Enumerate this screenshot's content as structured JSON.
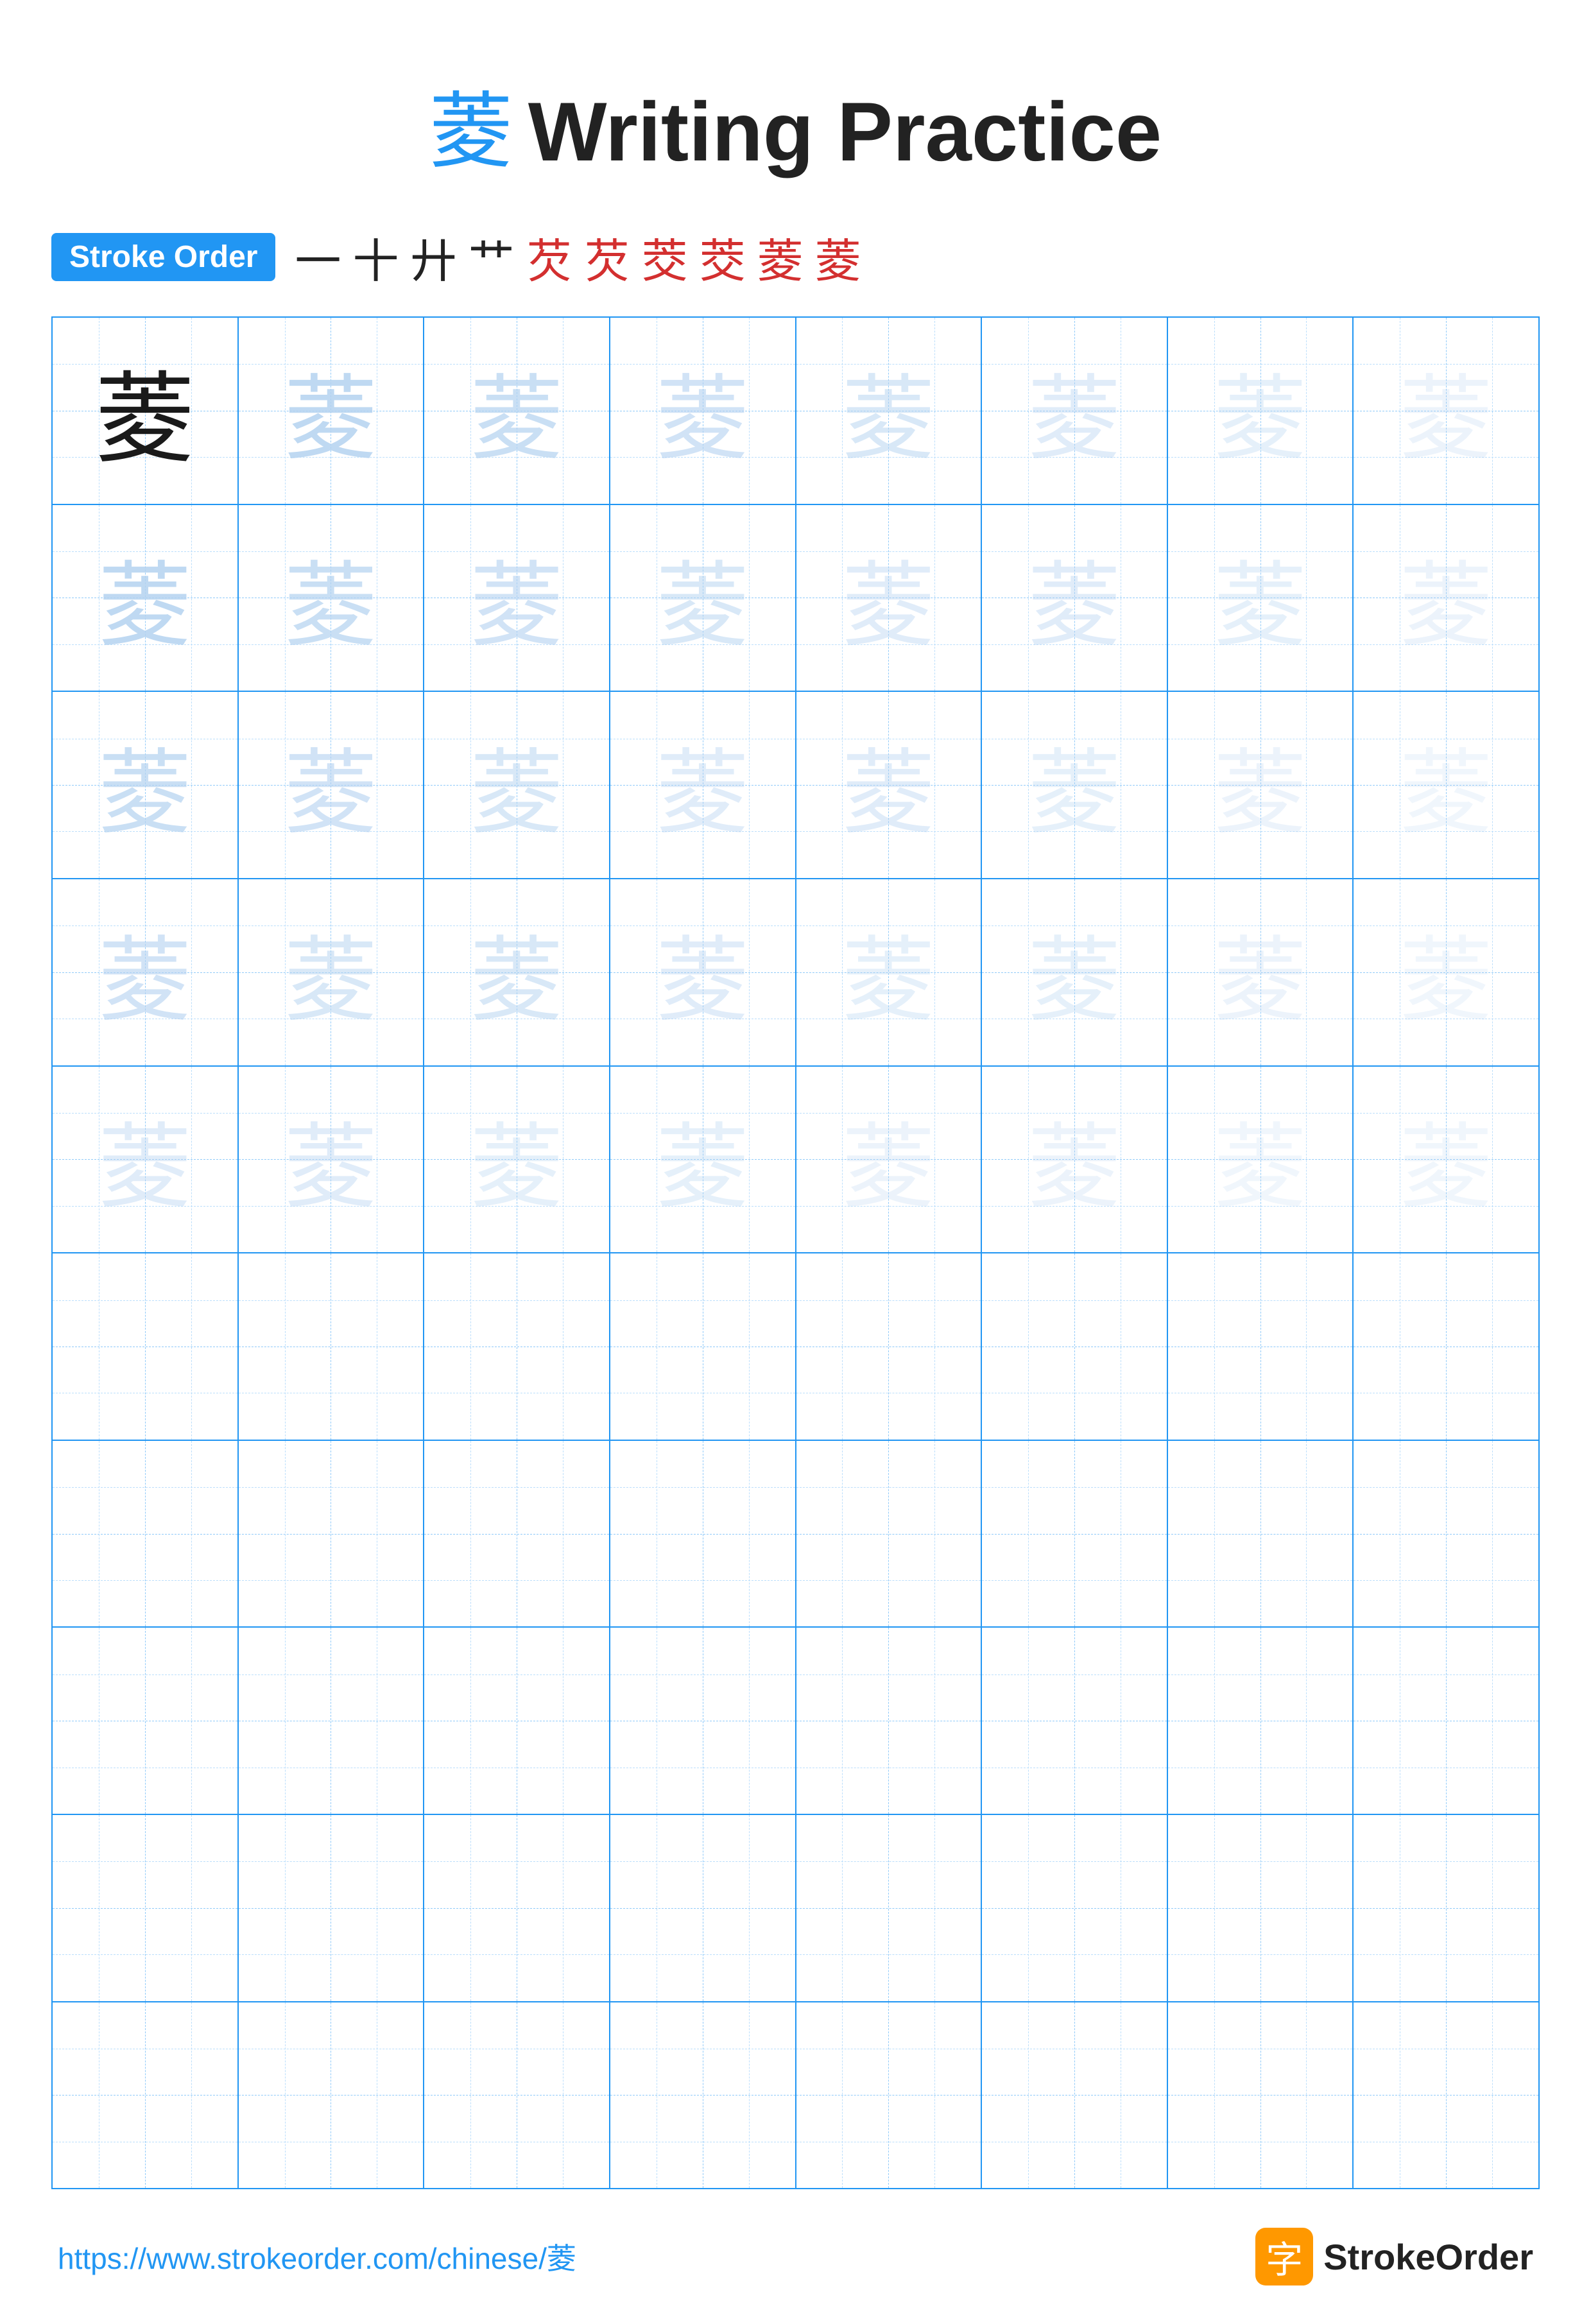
{
  "title": {
    "char": "菱",
    "text": "Writing Practice"
  },
  "stroke_order": {
    "badge_label": "Stroke Order",
    "strokes": [
      "一",
      "十",
      "廾",
      "艹",
      "芡",
      "芡",
      "茭",
      "茭",
      "菱",
      "菱"
    ]
  },
  "grid": {
    "rows": 10,
    "cols": 8,
    "char": "菱",
    "practice_rows": 5,
    "blank_rows": 5
  },
  "footer": {
    "url": "https://www.strokeorder.com/chinese/菱",
    "brand_char": "字",
    "brand_name": "StrokeOrder"
  }
}
